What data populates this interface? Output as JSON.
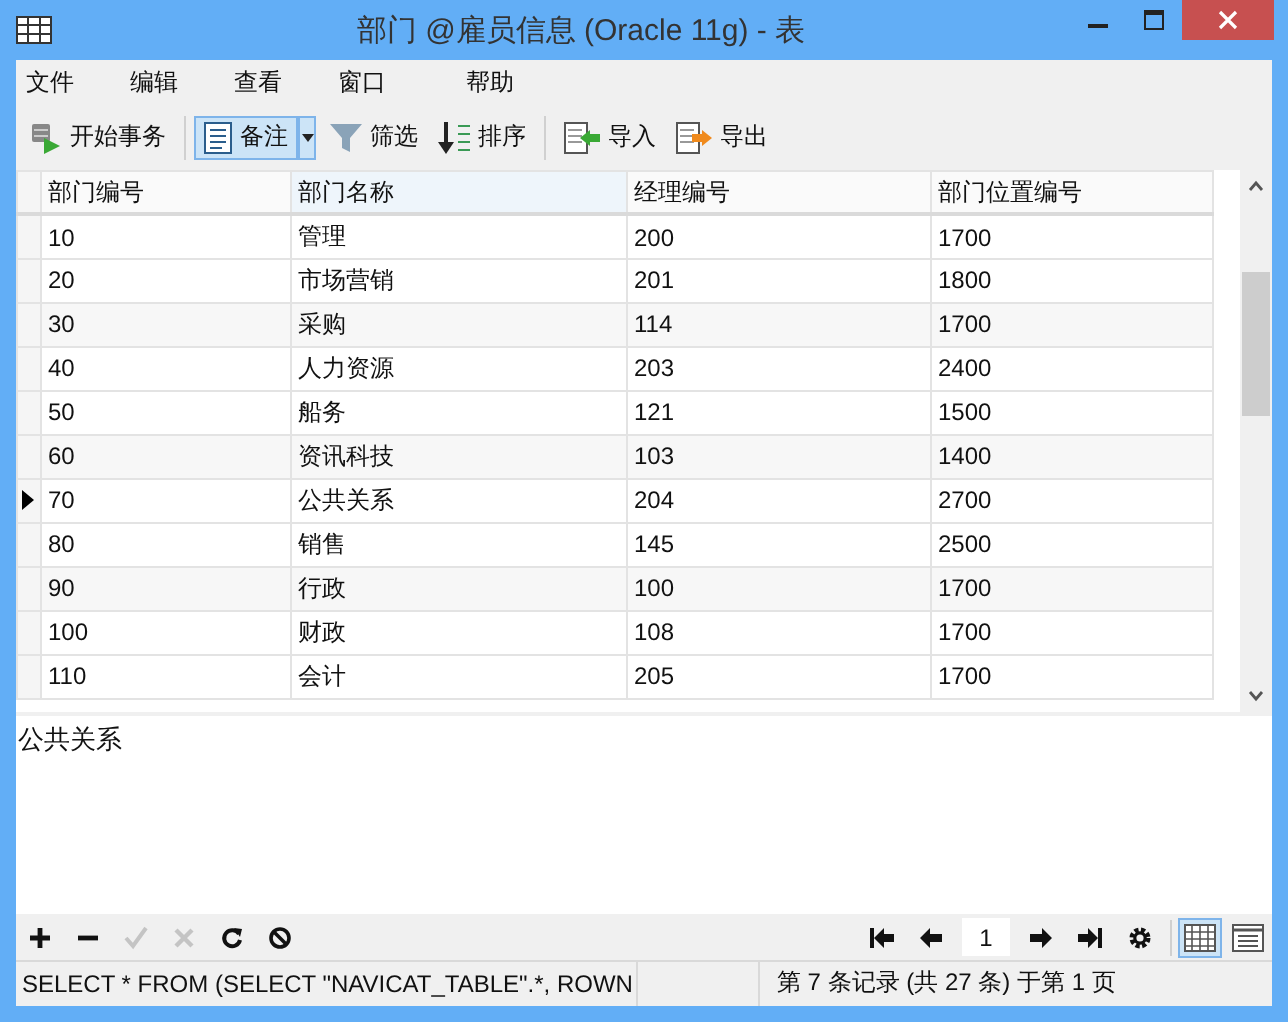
{
  "window": {
    "title": "部门 @雇员信息 (Oracle 11g) - 表"
  },
  "menu": [
    "文件",
    "编辑",
    "查看",
    "窗口",
    "帮助"
  ],
  "toolbar": [
    {
      "kind": "begin",
      "label": "开始事务",
      "selected": false
    },
    {
      "kind": "memo",
      "label": "备注",
      "selected": true
    },
    {
      "kind": "filter",
      "label": "筛选",
      "selected": false
    },
    {
      "kind": "sort",
      "label": "排序",
      "selected": false
    },
    {
      "kind": "import",
      "label": "导入",
      "selected": false
    },
    {
      "kind": "export",
      "label": "导出",
      "selected": false
    }
  ],
  "table": {
    "columns": [
      "部门编号",
      "部门名称",
      "经理编号",
      "部门位置编号"
    ],
    "rows": [
      {
        "cells": [
          "10",
          "管理",
          "200",
          "1700"
        ],
        "selected": false
      },
      {
        "cells": [
          "20",
          "市场营销",
          "201",
          "1800"
        ],
        "selected": false
      },
      {
        "cells": [
          "30",
          "采购",
          "114",
          "1700"
        ],
        "selected": false
      },
      {
        "cells": [
          "40",
          "人力资源",
          "203",
          "2400"
        ],
        "selected": false
      },
      {
        "cells": [
          "50",
          "船务",
          "121",
          "1500"
        ],
        "selected": false
      },
      {
        "cells": [
          "60",
          "资讯科技",
          "103",
          "1400"
        ],
        "selected": false
      },
      {
        "cells": [
          "70",
          "公共关系",
          "204",
          "2700"
        ],
        "selected": true
      },
      {
        "cells": [
          "80",
          "销售",
          "145",
          "2500"
        ],
        "selected": false
      },
      {
        "cells": [
          "90",
          "行政",
          "100",
          "1700"
        ],
        "selected": false
      },
      {
        "cells": [
          "100",
          "财政",
          "108",
          "1700"
        ],
        "selected": false
      },
      {
        "cells": [
          "110",
          "会计",
          "205",
          "1700"
        ],
        "selected": false
      }
    ]
  },
  "memo": "公共关系",
  "record_tools": [
    {
      "kind": "add",
      "disabled": false
    },
    {
      "kind": "delete",
      "disabled": false
    },
    {
      "kind": "apply",
      "disabled": true
    },
    {
      "kind": "cancel",
      "disabled": true
    },
    {
      "kind": "refresh",
      "disabled": false
    },
    {
      "kind": "stop",
      "disabled": false
    }
  ],
  "page": "1",
  "views": [
    {
      "kind": "grid",
      "selected": true
    },
    {
      "kind": "form",
      "selected": false
    }
  ],
  "status_bar": {
    "query": "SELECT * FROM (SELECT \"NAVICAT_TABLE\".*, ROWN",
    "record": "第 7 条记录 (共 27 条) 于第 1 页"
  }
}
